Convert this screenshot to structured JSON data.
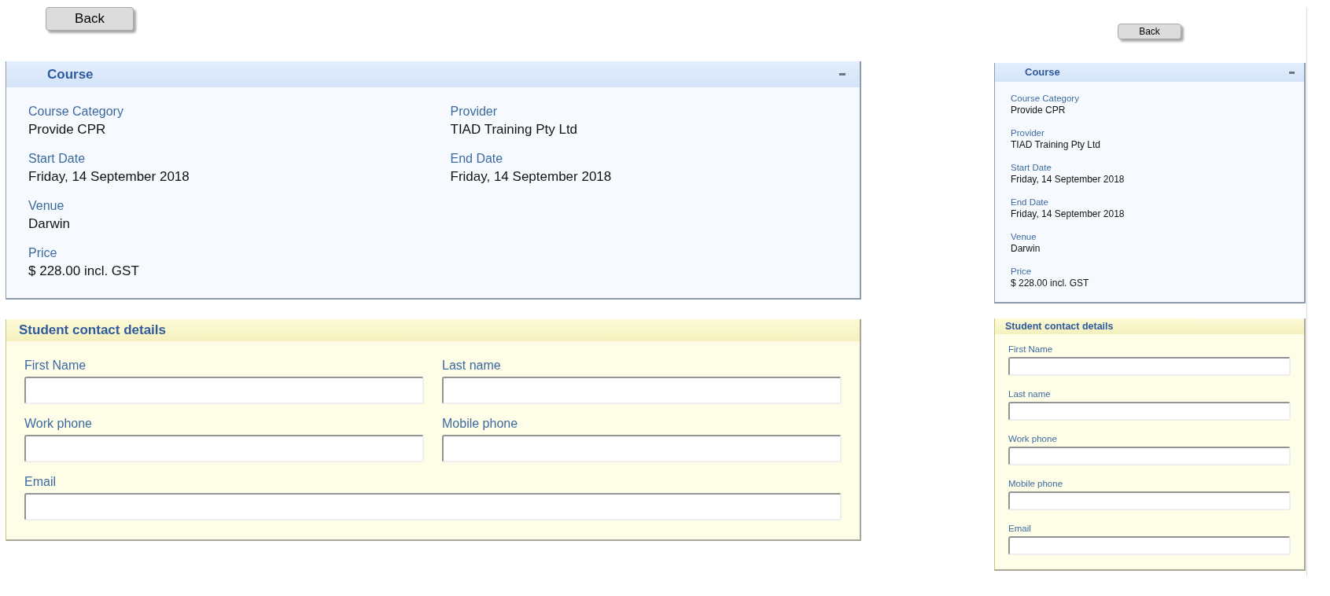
{
  "views": [
    {
      "kind": "wide",
      "back_button": "Back",
      "course": {
        "title": "Course",
        "expanded": true,
        "fields": [
          {
            "label": "Course Category",
            "value": "Provide CPR"
          },
          {
            "label": "Provider",
            "value": "TIAD Training Pty Ltd"
          },
          {
            "label": "Start Date",
            "value": "Friday, 14 September 2018"
          },
          {
            "label": "End Date",
            "value": "Friday, 14 September 2018"
          },
          {
            "label": "Venue",
            "value": "Darwin"
          },
          {
            "label": "Price",
            "value": "$ 228.00 incl. GST"
          }
        ]
      },
      "contact": {
        "title": "Student contact details",
        "fields": [
          {
            "label": "First Name"
          },
          {
            "label": "Last name"
          },
          {
            "label": "Work phone"
          },
          {
            "label": "Mobile phone"
          },
          {
            "label": "Email"
          }
        ]
      }
    },
    {
      "kind": "narrow",
      "back_button": "Back",
      "course": {
        "title": "Course",
        "expanded": true,
        "fields": [
          {
            "label": "Course Category",
            "value": "Provide CPR"
          },
          {
            "label": "Provider",
            "value": "TIAD Training Pty Ltd"
          },
          {
            "label": "Start Date",
            "value": "Friday, 14 September 2018"
          },
          {
            "label": "End Date",
            "value": "Friday, 14 September 2018"
          },
          {
            "label": "Venue",
            "value": "Darwin"
          },
          {
            "label": "Price",
            "value": "$ 228.00 incl. GST"
          }
        ]
      },
      "contact": {
        "title": "Student contact details",
        "fields": [
          {
            "label": "First Name"
          },
          {
            "label": "Last name"
          },
          {
            "label": "Work phone"
          },
          {
            "label": "Mobile phone"
          },
          {
            "label": "Email"
          }
        ]
      }
    }
  ]
}
